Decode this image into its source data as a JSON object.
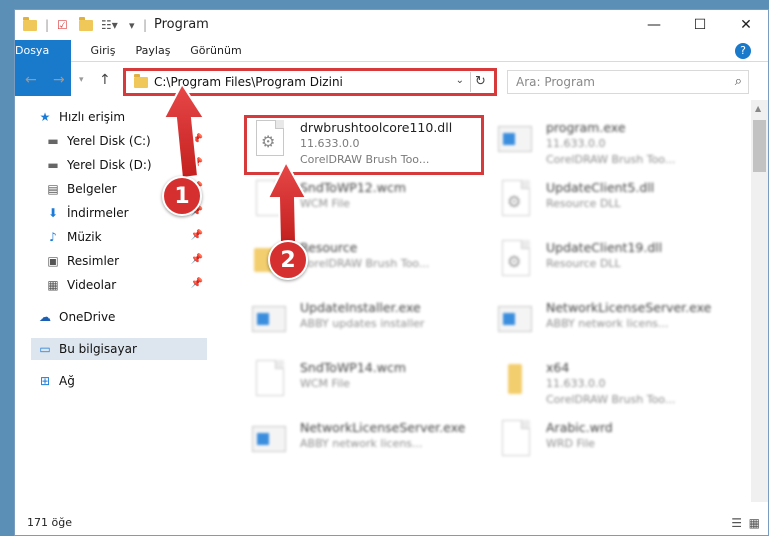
{
  "window": {
    "title": "Program",
    "minimize": "—",
    "maximize": "☐",
    "close": "✕"
  },
  "ribbon": {
    "tabs": [
      "Dosya",
      "Giriş",
      "Paylaş",
      "Görünüm"
    ],
    "help": "?"
  },
  "address": {
    "path": "C:\\Program Files\\Program Dizini",
    "search_placeholder": "Ara: Program"
  },
  "sidebar": {
    "items": [
      {
        "label": "Hızlı erişim",
        "icon": "star-icon",
        "pinned": false
      },
      {
        "label": "Yerel Disk (C:)",
        "icon": "drive-icon",
        "pinned": true
      },
      {
        "label": "Yerel Disk (D:)",
        "icon": "drive-icon",
        "pinned": true
      },
      {
        "label": "Belgeler",
        "icon": "document-icon",
        "pinned": true
      },
      {
        "label": "İndirmeler",
        "icon": "download-icon",
        "pinned": true
      },
      {
        "label": "Müzik",
        "icon": "music-icon",
        "pinned": true
      },
      {
        "label": "Resimler",
        "icon": "image-icon",
        "pinned": true
      },
      {
        "label": "Videolar",
        "icon": "video-icon",
        "pinned": true
      },
      {
        "label": "OneDrive",
        "icon": "cloud-icon",
        "pinned": false
      },
      {
        "label": "Bu bilgisayar",
        "icon": "computer-icon",
        "pinned": false
      },
      {
        "label": "Ağ",
        "icon": "network-icon",
        "pinned": false
      }
    ]
  },
  "files": [
    {
      "name": "drwbrushtoolcore110.dll",
      "line1": "11.633.0.0",
      "line2": "CorelDRAW Brush Too...",
      "type": "dll"
    },
    {
      "name": "program.exe",
      "line1": "11.633.0.0",
      "line2": "CorelDRAW Brush Too...",
      "type": "exe"
    },
    {
      "name": "SndToWP12.wcm",
      "line1": "WCM File",
      "line2": "",
      "type": "dll"
    },
    {
      "name": "UpdateClient5.dll",
      "line1": "Resource DLL",
      "line2": "",
      "type": "dll"
    },
    {
      "name": "Resource",
      "line1": "CorelDRAW Brush Too...",
      "line2": "",
      "type": "folder"
    },
    {
      "name": "UpdateClient19.dll",
      "line1": "Resource DLL",
      "line2": "",
      "type": "dll"
    },
    {
      "name": "UpdateInstaller.exe",
      "line1": "ABBY updates installer",
      "line2": "",
      "type": "exe"
    },
    {
      "name": "NetworkLicenseServer.exe",
      "line1": "ABBY network licens...",
      "line2": "",
      "type": "exe"
    },
    {
      "name": "SndToWP14.wcm",
      "line1": "WCM File",
      "line2": "",
      "type": "dll"
    },
    {
      "name": "x64",
      "line1": "11.633.0.0",
      "line2": "CorelDRAW Brush Too...",
      "type": "folder"
    },
    {
      "name": "NetworkLicenseServer.exe",
      "line1": "ABBY network licens...",
      "line2": "",
      "type": "exe"
    },
    {
      "name": "Arabic.wrd",
      "line1": "WRD File",
      "line2": "",
      "type": "dll"
    }
  ],
  "status": {
    "count": "171 öğe"
  },
  "annotations": [
    "1",
    "2"
  ],
  "colors": {
    "accent": "#1979ca",
    "highlight": "#d63a3a"
  }
}
